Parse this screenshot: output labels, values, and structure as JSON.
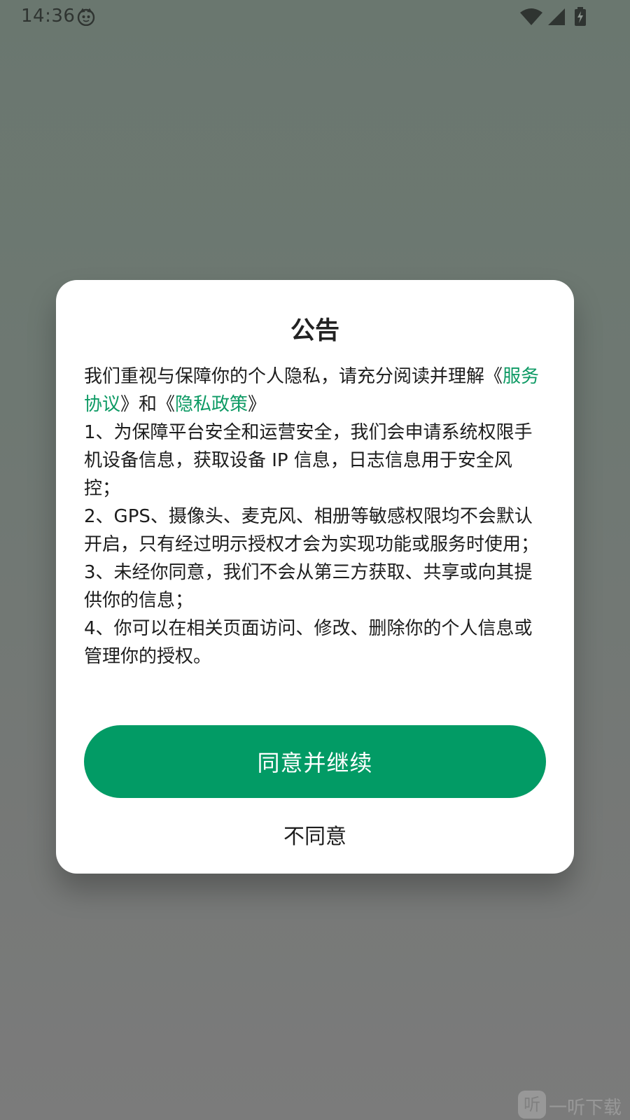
{
  "status_bar": {
    "time": "14:36"
  },
  "dialog": {
    "title": "公告",
    "intro_text": "我们重视与保障你的个人隐私，请充分阅读并理解",
    "quote_open_1": "《",
    "service_link": "服务协议",
    "and_text": "》和《",
    "privacy_link": "隐私政策",
    "quote_close_2": "》",
    "item_1": "1、为保障平台安全和运营安全，我们会申请系统权限手机设备信息，获取设备 IP 信息，日志信息用于安全风控；",
    "item_2": "2、GPS、摄像头、麦克风、相册等敏感权限均不会默认开启，只有经过明示授权才会为实现功能或服务时使用；",
    "item_3": "3、未经你同意，我们不会从第三方获取、共享或向其提供你的信息；",
    "item_4": "4、你可以在相关页面访问、修改、删除你的个人信息或管理你的授权。",
    "agree_label": "同意并继续",
    "disagree_label": "不同意"
  },
  "watermark": {
    "logo_char": "听",
    "text": "一听下载"
  },
  "colors": {
    "accent": "#029b65",
    "link": "#0d9a64",
    "overlay": "#707774"
  }
}
